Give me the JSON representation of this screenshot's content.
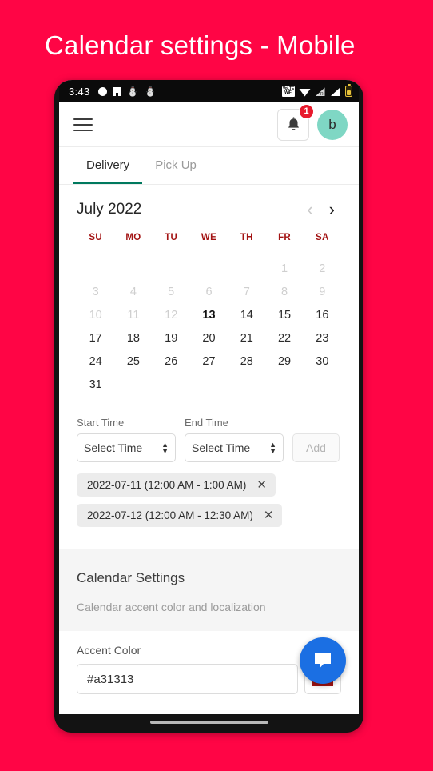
{
  "page": {
    "title": "Calendar settings - Mobile",
    "background_color": "#ff0545"
  },
  "statusbar": {
    "clock": "3:43",
    "left_icons": [
      "circle-notification-icon",
      "app-notification-icon",
      "gmail-icon",
      "gmail-icon"
    ],
    "right_icons": [
      "vowifi-icon",
      "wifi-icon",
      "signal-roaming-icon",
      "signal-icon",
      "battery-icon"
    ],
    "vowifi_label_line1": "VoLTE",
    "vowifi_label_line2": "WiFi"
  },
  "appbar": {
    "menu_icon": "hamburger-menu-icon",
    "bell_icon": "notification-bell-icon",
    "badge_count": "1",
    "avatar_initial": "b",
    "avatar_color": "#7fd7c4",
    "badge_color": "#e8192c"
  },
  "tabs": {
    "items": [
      {
        "label": "Delivery",
        "active": true
      },
      {
        "label": "Pick Up",
        "active": false
      }
    ],
    "active_underline_color": "#00795e"
  },
  "calendar": {
    "month_label": "July 2022",
    "prev_icon": "chevron-left-icon",
    "next_icon": "chevron-right-icon",
    "weekdays": [
      "SU",
      "MO",
      "TU",
      "WE",
      "TH",
      "FR",
      "SA"
    ],
    "weekday_color": "#a31313",
    "leading_blanks": 5,
    "days": [
      {
        "n": "1",
        "state": "disabled"
      },
      {
        "n": "2",
        "state": "disabled"
      },
      {
        "n": "3",
        "state": "disabled"
      },
      {
        "n": "4",
        "state": "disabled"
      },
      {
        "n": "5",
        "state": "disabled"
      },
      {
        "n": "6",
        "state": "disabled"
      },
      {
        "n": "7",
        "state": "disabled"
      },
      {
        "n": "8",
        "state": "disabled"
      },
      {
        "n": "9",
        "state": "disabled"
      },
      {
        "n": "10",
        "state": "disabled"
      },
      {
        "n": "11",
        "state": "disabled"
      },
      {
        "n": "12",
        "state": "disabled"
      },
      {
        "n": "13",
        "state": "today"
      },
      {
        "n": "14",
        "state": "enabled"
      },
      {
        "n": "15",
        "state": "enabled"
      },
      {
        "n": "16",
        "state": "enabled"
      },
      {
        "n": "17",
        "state": "enabled"
      },
      {
        "n": "18",
        "state": "enabled"
      },
      {
        "n": "19",
        "state": "enabled"
      },
      {
        "n": "20",
        "state": "enabled"
      },
      {
        "n": "21",
        "state": "enabled"
      },
      {
        "n": "22",
        "state": "enabled"
      },
      {
        "n": "23",
        "state": "enabled"
      },
      {
        "n": "24",
        "state": "enabled"
      },
      {
        "n": "25",
        "state": "enabled"
      },
      {
        "n": "26",
        "state": "enabled"
      },
      {
        "n": "27",
        "state": "enabled"
      },
      {
        "n": "28",
        "state": "enabled"
      },
      {
        "n": "29",
        "state": "enabled"
      },
      {
        "n": "30",
        "state": "enabled"
      },
      {
        "n": "31",
        "state": "enabled"
      }
    ]
  },
  "time_form": {
    "start_label": "Start Time",
    "start_value": "Select Time",
    "end_label": "End Time",
    "end_value": "Select Time",
    "add_label": "Add",
    "add_disabled": true
  },
  "slots": [
    {
      "text": "2022-07-11 (12:00 AM - 1:00 AM)",
      "remove_icon": "close-icon"
    },
    {
      "text": "2022-07-12 (12:00 AM - 12:30 AM)",
      "remove_icon": "close-icon"
    }
  ],
  "settings": {
    "title": "Calendar Settings",
    "subtitle": "Calendar accent color and localization",
    "accent_label": "Accent Color",
    "accent_value": "#a31313",
    "accent_color": "#a31313"
  },
  "fab": {
    "icon": "chat-bubble-icon",
    "color": "#1b6fe3"
  }
}
